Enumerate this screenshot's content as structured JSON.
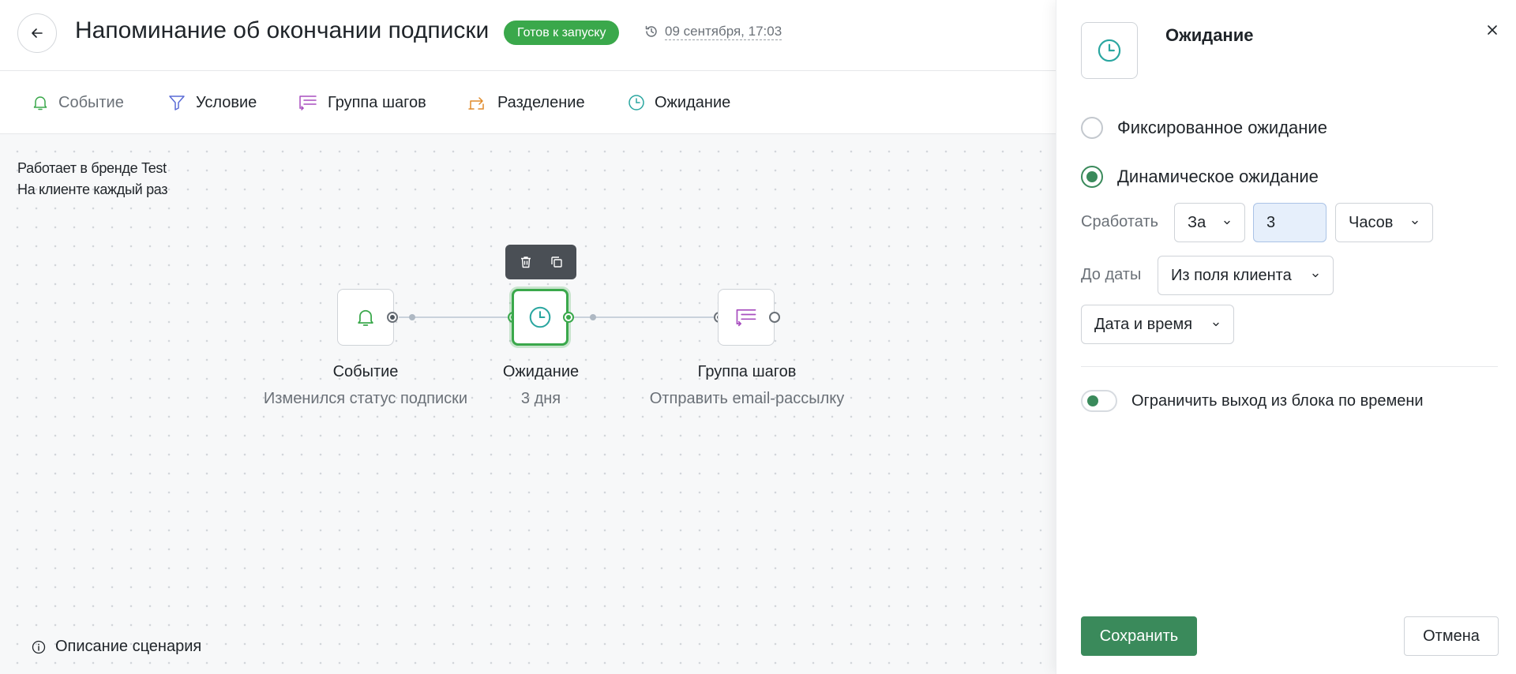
{
  "header": {
    "title": "Напоминание об окончании подписки",
    "status": "Готов к запуску",
    "history_date": "09 сентября, 17:03"
  },
  "toolbar": {
    "items": [
      {
        "label": "Событие",
        "icon": "bell-icon",
        "color": "#3aa84b"
      },
      {
        "label": "Условие",
        "icon": "filter-icon",
        "color": "#5a6bd6"
      },
      {
        "label": "Группа шагов",
        "icon": "step-group-icon",
        "color": "#a84fbf"
      },
      {
        "label": "Разделение",
        "icon": "split-icon",
        "color": "#e08a2a"
      },
      {
        "label": "Ожидание",
        "icon": "clock-icon",
        "color": "#2aa6a0"
      }
    ]
  },
  "canvas": {
    "info_line1": "Работает в бренде Test",
    "info_line2": "На клиенте каждый раз",
    "nodes": [
      {
        "title": "Событие",
        "subtitle": "Изменился статус подписки",
        "icon": "bell-icon"
      },
      {
        "title": "Ожидание",
        "subtitle": "3 дня",
        "icon": "clock-icon"
      },
      {
        "title": "Группа шагов",
        "subtitle": "Отправить email-рассылку",
        "icon": "step-group-icon"
      }
    ],
    "scenario_description": "Описание сценария"
  },
  "panel": {
    "title": "Ожидание",
    "radio_fixed": "Фиксированное ожидание",
    "radio_dynamic": "Динамическое ожидание",
    "selected_mode": "dynamic",
    "trigger_label": "Сработать",
    "trigger_prefix": "За",
    "trigger_value": "3",
    "trigger_unit": "Часов",
    "until_label": "До даты",
    "until_source": "Из поля клиента",
    "datetime_field": "Дата и время",
    "limit_exit_label": "Ограничить выход из блока по времени",
    "save_label": "Сохранить",
    "cancel_label": "Отмена"
  },
  "colors": {
    "accent_green": "#3aa84b",
    "panel_green": "#3a8a5b",
    "clock_teal": "#2aa6a0"
  }
}
